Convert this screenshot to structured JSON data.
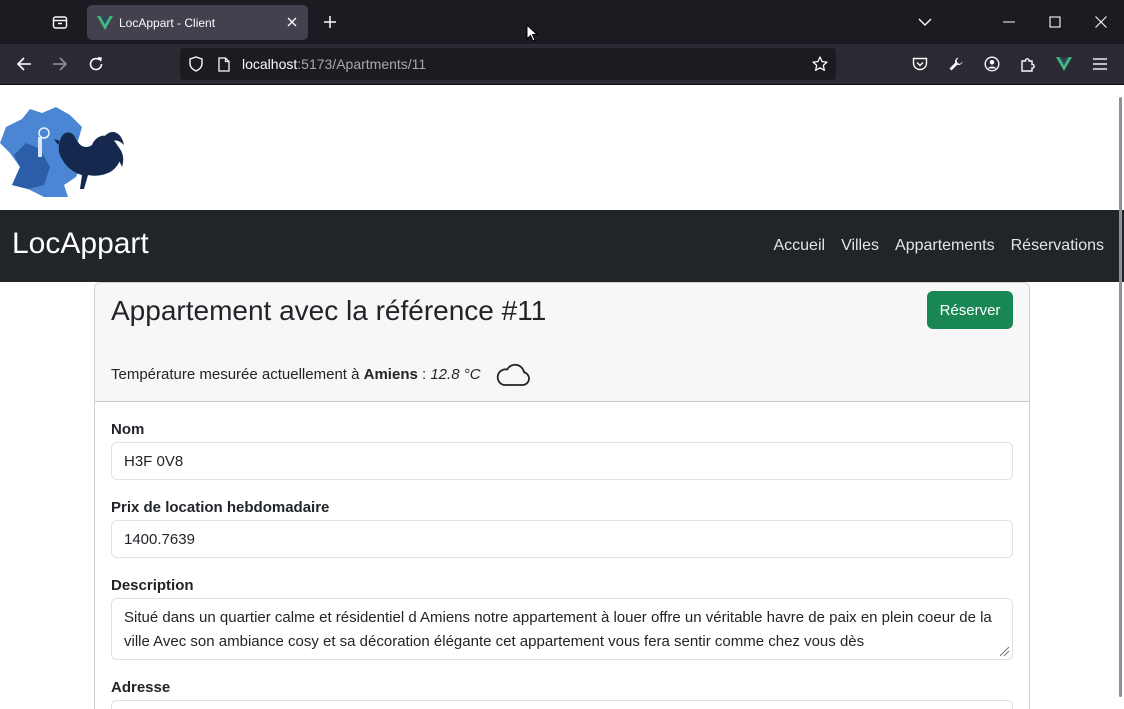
{
  "browser": {
    "tab_title": "LocAppart - Client",
    "url_host": "localhost",
    "url_path": ":5173/Apartments/11",
    "colors": {
      "tab_bg": "#42414d",
      "chrome_bg": "#1c1b22",
      "vue_green": "#41b883"
    }
  },
  "site": {
    "brand": "LocAppart",
    "nav": [
      "Accueil",
      "Villes",
      "Appartements",
      "Réservations"
    ]
  },
  "apartment": {
    "title": "Appartement avec la référence #11",
    "reserve_label": "Réserver",
    "temp_prefix": "Température mesurée actuellement à ",
    "city": "Amiens",
    "temp_sep": " : ",
    "temperature": "12.8 °C",
    "weather_icon": "cloud-icon",
    "fields": {
      "name_label": "Nom",
      "name_value": "H3F 0V8",
      "price_label": "Prix de location hebdomadaire",
      "price_value": "1400.7639",
      "description_label": "Description",
      "description_value": "Situé dans un quartier calme et résidentiel d Amiens notre appartement à louer offre un véritable havre de paix en plein coeur de la ville Avec son ambiance cosy et sa décoration élégante cet appartement vous fera sentir comme chez vous dès",
      "address_label": "Adresse"
    },
    "colors": {
      "reserve_bg": "#198754",
      "navbar_bg": "#212529"
    }
  }
}
